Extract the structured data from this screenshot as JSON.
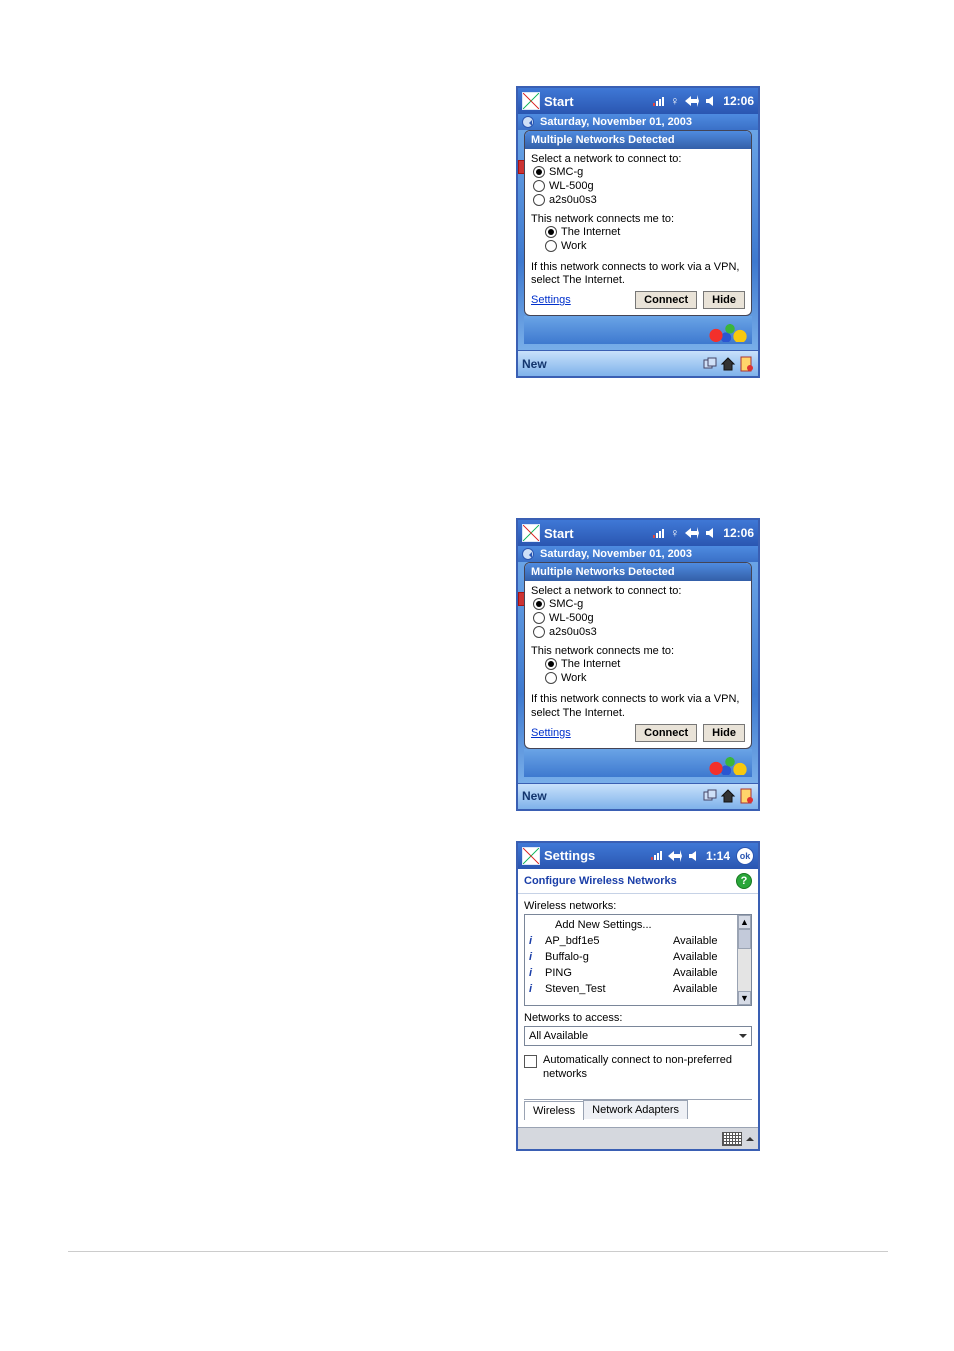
{
  "screens": {
    "netdetect": {
      "topbar": {
        "title": "Start",
        "clock": "12:06"
      },
      "date": "Saturday, November 01, 2003",
      "bubble": {
        "title": "Multiple Networks Detected",
        "select_label": "Select a network to connect to:",
        "networks": [
          {
            "name": "SMC-g",
            "selected": true
          },
          {
            "name": "WL-500g",
            "selected": false
          },
          {
            "name": "a2s0u0s3",
            "selected": false
          }
        ],
        "connects_label": "This network connects me to:",
        "connects_options": [
          {
            "name": "The Internet",
            "selected": true
          },
          {
            "name": "Work",
            "selected": false
          }
        ],
        "vpn_hint": "If this network connects to work via a VPN, select The Internet.",
        "settings_link": "Settings",
        "connect_btn": "Connect",
        "hide_btn": "Hide"
      },
      "bottombar": {
        "new_label": "New"
      }
    },
    "configure": {
      "topbar": {
        "title": "Settings",
        "clock": "1:14"
      },
      "header": "Configure Wireless Networks",
      "wireless_label": "Wireless networks:",
      "add_new": "Add New Settings...",
      "networks": [
        {
          "name": "AP_bdf1e5",
          "status": "Available"
        },
        {
          "name": "Buffalo-g",
          "status": "Available"
        },
        {
          "name": "PING",
          "status": "Available"
        },
        {
          "name": "Steven_Test",
          "status": "Available"
        }
      ],
      "access_label": "Networks to access:",
      "access_value": "All Available",
      "auto_connect_label": "Automatically connect to non-preferred networks",
      "tabs": {
        "wireless": "Wireless",
        "adapters": "Network Adapters"
      }
    }
  }
}
